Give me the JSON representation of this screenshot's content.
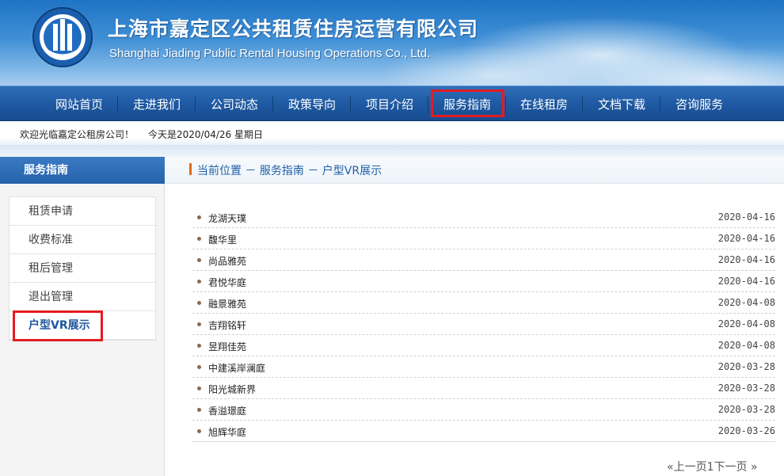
{
  "header": {
    "title_cn": "上海市嘉定区公共租赁住房运营有限公司",
    "title_en": "Shanghai Jiading Public Rental Housing Operations Co., Ltd.",
    "logo_icon": "company-logo-icon"
  },
  "nav": {
    "items": [
      {
        "label": "网站首页"
      },
      {
        "label": "走进我们"
      },
      {
        "label": "公司动态"
      },
      {
        "label": "政策导向"
      },
      {
        "label": "项目介绍"
      },
      {
        "label": "服务指南",
        "active": true
      },
      {
        "label": "在线租房"
      },
      {
        "label": "文档下载"
      },
      {
        "label": "咨询服务"
      }
    ]
  },
  "welcome": {
    "message": "欢迎光临嘉定公租房公司！",
    "date": "今天是2020/04/26 星期日"
  },
  "sidebar": {
    "heading": "服务指南",
    "items": [
      {
        "label": "租赁申请"
      },
      {
        "label": "收费标准"
      },
      {
        "label": "租后管理"
      },
      {
        "label": "退出管理"
      },
      {
        "label": "户型VR展示",
        "active": true
      }
    ]
  },
  "breadcrumb": {
    "text": "当前位置 － 服务指南 － 户型VR展示"
  },
  "list": {
    "items": [
      {
        "title": "龙湖天璞",
        "date": "2020-04-16"
      },
      {
        "title": "馥华里",
        "date": "2020-04-16"
      },
      {
        "title": "尚品雅苑",
        "date": "2020-04-16"
      },
      {
        "title": "君悦华庭",
        "date": "2020-04-16"
      },
      {
        "title": "融景雅苑",
        "date": "2020-04-08"
      },
      {
        "title": "吉翔铭轩",
        "date": "2020-04-08"
      },
      {
        "title": "昱翔佳苑",
        "date": "2020-04-08"
      },
      {
        "title": "中建溪岸澜庭",
        "date": "2020-03-28"
      },
      {
        "title": "阳光城新界",
        "date": "2020-03-28"
      },
      {
        "title": "香溢璟庭",
        "date": "2020-03-28"
      },
      {
        "title": "旭辉华庭",
        "date": "2020-03-26"
      }
    ]
  },
  "pager": {
    "prev": "«上一页",
    "page": "1",
    "next": "下一页 »"
  },
  "colors": {
    "nav_bg": "#1f5aa3",
    "sidebar_head_bg": "#2462ab",
    "link_blue": "#1f5fa8",
    "highlight_red": "#e41b23"
  }
}
